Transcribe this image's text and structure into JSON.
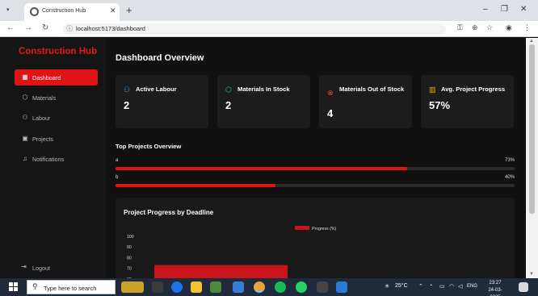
{
  "browser": {
    "tab_title": "Construction Hub",
    "url": "localhost:5173/dashboard"
  },
  "sidebar": {
    "brand": "Construction Hub",
    "items": [
      {
        "label": "Dashboard",
        "icon": "dashboard-icon",
        "active": true
      },
      {
        "label": "Materials",
        "icon": "materials-icon",
        "active": false
      },
      {
        "label": "Labour",
        "icon": "labour-icon",
        "active": false
      },
      {
        "label": "Projects",
        "icon": "projects-icon",
        "active": false
      },
      {
        "label": "Notifications",
        "icon": "bell-icon",
        "active": false
      }
    ],
    "logout": "Logout"
  },
  "main": {
    "title": "Dashboard Overview",
    "cards": [
      {
        "label": "Active Labour",
        "value": "2",
        "icon": "labour-icon",
        "color": "#4a90e2"
      },
      {
        "label": "Materials In Stock",
        "value": "2",
        "icon": "cube-icon",
        "color": "#2ecc71"
      },
      {
        "label": "Materials Out of Stock",
        "value": "4",
        "icon": "x-circle-icon",
        "color": "#e74c3c"
      },
      {
        "label": "Avg. Project Progress",
        "value": "57%",
        "icon": "bar-chart-icon",
        "color": "#f5b400"
      }
    ],
    "top_projects": {
      "title": "Top Projects Overview",
      "rows": [
        {
          "name": "a",
          "percent_text": "73%",
          "value": 73
        },
        {
          "name": "b",
          "percent_text": "40%",
          "value": 40
        }
      ]
    },
    "chart_title": "Project Progress by Deadline"
  },
  "chart_data": {
    "type": "bar",
    "title": "Project Progress by Deadline",
    "series": [
      {
        "name": "Progress (%)",
        "values": [
          73
        ]
      }
    ],
    "legend": "top",
    "y_ticks_visible": [
      100,
      90,
      80,
      70,
      60
    ],
    "ylim": [
      0,
      100
    ],
    "colors": {
      "bar": "#c8141b"
    }
  },
  "taskbar": {
    "search_placeholder": "Type here to search",
    "weather": "25°C",
    "language": "ENG",
    "time": "23:27",
    "date": "24-03-2025"
  },
  "colors": {
    "accent": "#e01414",
    "background": "#111111",
    "card": "#1c1c1c"
  }
}
